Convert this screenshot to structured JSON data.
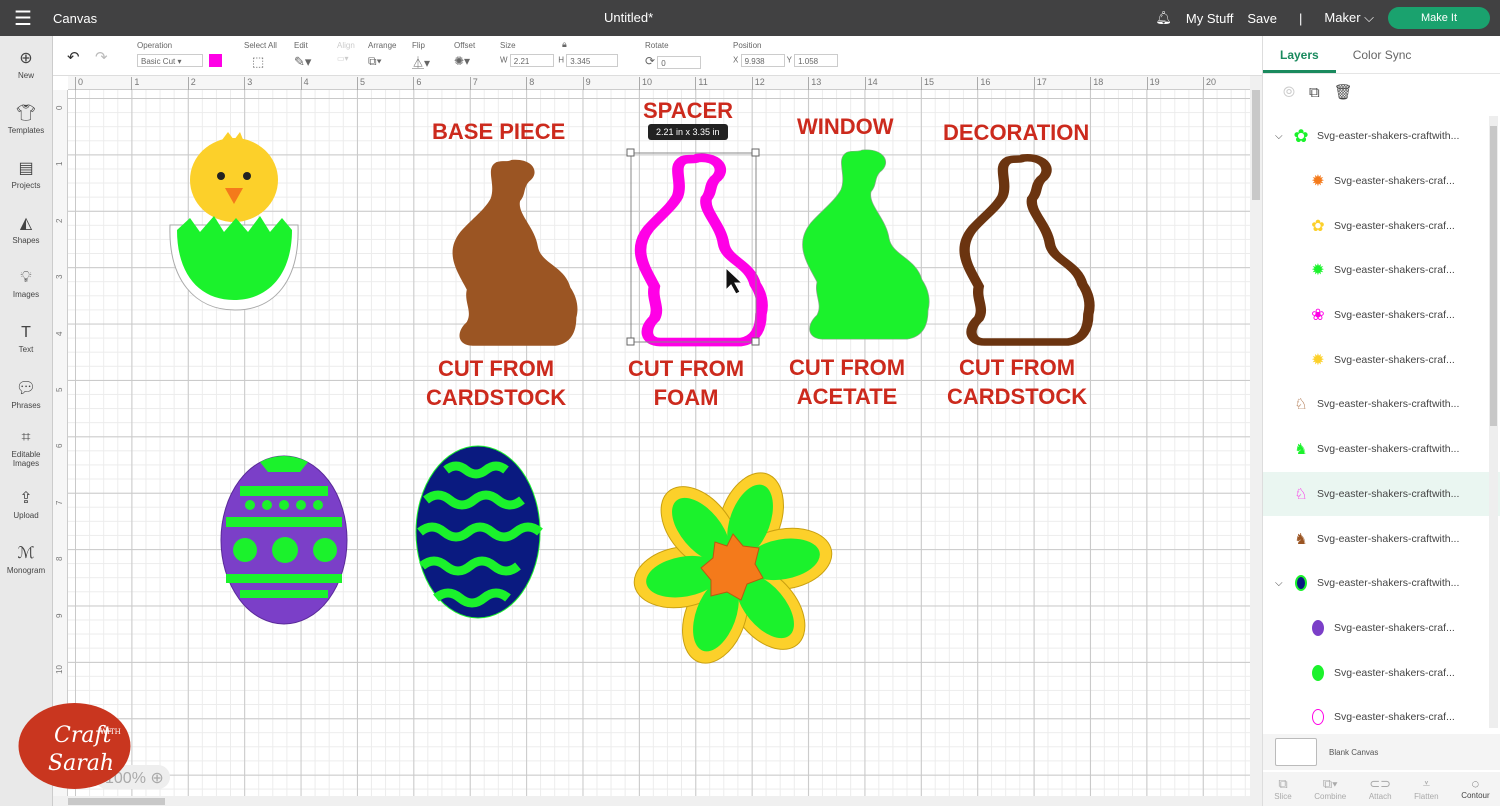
{
  "topbar": {
    "app": "Canvas",
    "title": "Untitled*",
    "my_stuff": "My Stuff",
    "save": "Save",
    "sep": "|",
    "machine": "Maker",
    "make_it": "Make It"
  },
  "toolbar": {
    "operation_label": "Operation",
    "operation_value": "Basic Cut",
    "operation_color": "#ff00e6",
    "select_all": "Select All",
    "edit": "Edit",
    "align": "Align",
    "arrange": "Arrange",
    "flip": "Flip",
    "offset": "Offset",
    "size": "Size",
    "w_label": "W",
    "w_value": "2.21",
    "h_label": "H",
    "h_value": "3.345",
    "rotate": "Rotate",
    "rotate_value": "0",
    "position": "Position",
    "x_label": "X",
    "x_value": "9.938",
    "y_label": "Y",
    "y_value": "1.058"
  },
  "sidebar": [
    {
      "label": "New",
      "icon": "plus-circle-icon"
    },
    {
      "label": "Templates",
      "icon": "shirt-icon"
    },
    {
      "label": "Projects",
      "icon": "projects-icon"
    },
    {
      "label": "Shapes",
      "icon": "shapes-icon"
    },
    {
      "label": "Images",
      "icon": "bulb-icon"
    },
    {
      "label": "Text",
      "icon": "text-icon"
    },
    {
      "label": "Phrases",
      "icon": "speech-icon"
    },
    {
      "label": "Editable Images",
      "icon": "crop-icon"
    },
    {
      "label": "Upload",
      "icon": "upload-icon"
    },
    {
      "label": "Monogram",
      "icon": "monogram-icon"
    }
  ],
  "ruler_x": [
    "0",
    "1",
    "2",
    "3",
    "4",
    "5",
    "6",
    "7",
    "8",
    "9",
    "10",
    "11",
    "12",
    "13",
    "14",
    "15",
    "16",
    "17",
    "18",
    "19",
    "20"
  ],
  "ruler_y": [
    "0",
    "1",
    "2",
    "3",
    "4",
    "5",
    "6",
    "7",
    "8",
    "9",
    "10"
  ],
  "canvas": {
    "labels": {
      "base": "BASE PIECE",
      "base_cut": "CUT FROM\nCARDSTOCK",
      "spacer": "SPACER",
      "spacer_cut": "CUT FROM\nFOAM",
      "window": "WINDOW",
      "window_cut": "CUT FROM\nACETATE",
      "decoration": "DECORATION",
      "decoration_cut": "CUT FROM\nCARDSTOCK"
    },
    "selection_size": "2.21  in x 3.35  in",
    "zoom": "100%",
    "colors": {
      "brown": "#9b5523",
      "green": "#1bf22c",
      "magenta": "#ff00e6",
      "dark_brown": "#6b3410",
      "purple": "#7b3fc8",
      "navy": "#0a1a80",
      "yellow": "#fcd02a",
      "orange": "#f47a1b",
      "label": "#cc2a1d"
    }
  },
  "logo_text": "Craft with Sarah",
  "panel": {
    "tabs": [
      "Layers",
      "Color Sync"
    ],
    "layers": [
      {
        "name": "Svg-easter-shakers-craftwith...",
        "type": "group",
        "thumb": "flower"
      },
      {
        "name": "Svg-easter-shakers-craf...",
        "type": "child",
        "thumb": "orange-star"
      },
      {
        "name": "Svg-easter-shakers-craf...",
        "type": "child",
        "thumb": "yellow-flower"
      },
      {
        "name": "Svg-easter-shakers-craf...",
        "type": "child",
        "thumb": "green-star"
      },
      {
        "name": "Svg-easter-shakers-craf...",
        "type": "child",
        "thumb": "pink-flower"
      },
      {
        "name": "Svg-easter-shakers-craf...",
        "type": "child",
        "thumb": "yellow-star"
      },
      {
        "name": "Svg-easter-shakers-craftwith...",
        "type": "top",
        "thumb": "bunny-outline-brown"
      },
      {
        "name": "Svg-easter-shakers-craftwith...",
        "type": "top",
        "thumb": "bunny-green"
      },
      {
        "name": "Svg-easter-shakers-craftwith...",
        "type": "top",
        "thumb": "bunny-magenta",
        "selected": true
      },
      {
        "name": "Svg-easter-shakers-craftwith...",
        "type": "top",
        "thumb": "bunny-brown"
      },
      {
        "name": "Svg-easter-shakers-craftwith...",
        "type": "group",
        "thumb": "egg-navy"
      },
      {
        "name": "Svg-easter-shakers-craf...",
        "type": "child",
        "thumb": "egg-purple"
      },
      {
        "name": "Svg-easter-shakers-craf...",
        "type": "child",
        "thumb": "egg-green"
      },
      {
        "name": "Svg-easter-shakers-craf...",
        "type": "child",
        "thumb": "egg-outline-pink"
      }
    ],
    "blank_canvas": "Blank Canvas",
    "tools": [
      "Slice",
      "Combine",
      "Attach",
      "Flatten",
      "Contour"
    ]
  }
}
